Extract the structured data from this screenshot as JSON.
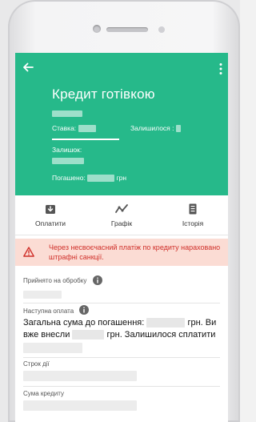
{
  "header": {
    "title": "Кредит готівкою",
    "rate_label": "Ставка:",
    "remaining_label": "Залишилося :",
    "balance_label": "Залишок:",
    "paid_label": "Погашено:",
    "paid_unit": "грн"
  },
  "actions": [
    {
      "label": "Оплатити",
      "icon": "download-icon"
    },
    {
      "label": "Графік",
      "icon": "chart-icon"
    },
    {
      "label": "Історія",
      "icon": "document-icon"
    }
  ],
  "alert": {
    "text": "Через несвоєчасний платіж по кредиту нараховано штрафні санкції."
  },
  "details": {
    "accepted_label": "Прийнято на обробку",
    "next_payment_label": "Наступна оплата",
    "text_part1": "Загальна сума до погашення:",
    "text_part2": "грн. Ви вже внесли",
    "text_part3": "грн. Залишилося сплатити",
    "term_label": "Строк дії",
    "amount_label": "Сума кредиту"
  },
  "colors": {
    "header_bg": "#26b98a",
    "alert_bg": "#fbdcd4",
    "alert_text": "#d0302a"
  }
}
